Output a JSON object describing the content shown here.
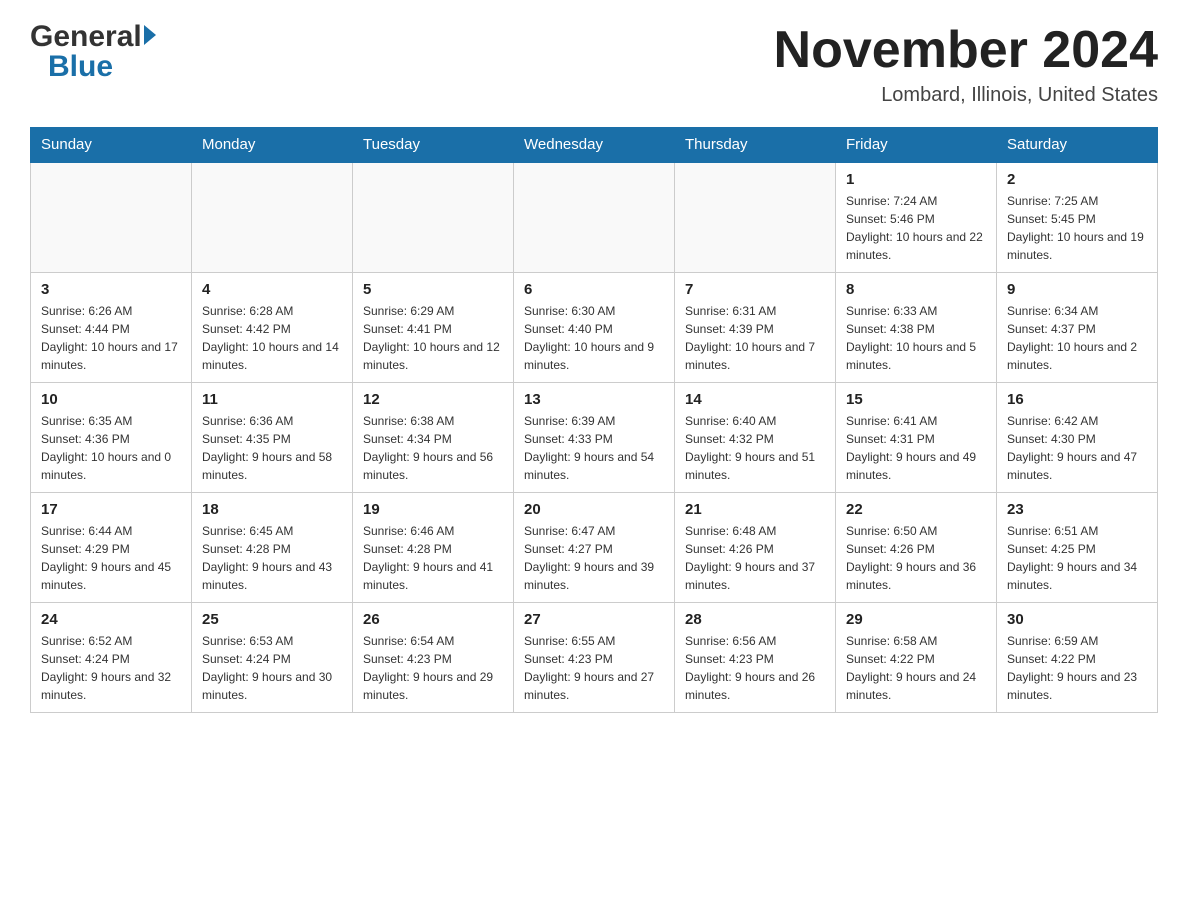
{
  "header": {
    "title": "November 2024",
    "subtitle": "Lombard, Illinois, United States",
    "logo_general": "General",
    "logo_blue": "Blue"
  },
  "days_of_week": [
    "Sunday",
    "Monday",
    "Tuesday",
    "Wednesday",
    "Thursday",
    "Friday",
    "Saturday"
  ],
  "weeks": [
    [
      {
        "day": "",
        "sunrise": "",
        "sunset": "",
        "daylight": ""
      },
      {
        "day": "",
        "sunrise": "",
        "sunset": "",
        "daylight": ""
      },
      {
        "day": "",
        "sunrise": "",
        "sunset": "",
        "daylight": ""
      },
      {
        "day": "",
        "sunrise": "",
        "sunset": "",
        "daylight": ""
      },
      {
        "day": "",
        "sunrise": "",
        "sunset": "",
        "daylight": ""
      },
      {
        "day": "1",
        "sunrise": "Sunrise: 7:24 AM",
        "sunset": "Sunset: 5:46 PM",
        "daylight": "Daylight: 10 hours and 22 minutes."
      },
      {
        "day": "2",
        "sunrise": "Sunrise: 7:25 AM",
        "sunset": "Sunset: 5:45 PM",
        "daylight": "Daylight: 10 hours and 19 minutes."
      }
    ],
    [
      {
        "day": "3",
        "sunrise": "Sunrise: 6:26 AM",
        "sunset": "Sunset: 4:44 PM",
        "daylight": "Daylight: 10 hours and 17 minutes."
      },
      {
        "day": "4",
        "sunrise": "Sunrise: 6:28 AM",
        "sunset": "Sunset: 4:42 PM",
        "daylight": "Daylight: 10 hours and 14 minutes."
      },
      {
        "day": "5",
        "sunrise": "Sunrise: 6:29 AM",
        "sunset": "Sunset: 4:41 PM",
        "daylight": "Daylight: 10 hours and 12 minutes."
      },
      {
        "day": "6",
        "sunrise": "Sunrise: 6:30 AM",
        "sunset": "Sunset: 4:40 PM",
        "daylight": "Daylight: 10 hours and 9 minutes."
      },
      {
        "day": "7",
        "sunrise": "Sunrise: 6:31 AM",
        "sunset": "Sunset: 4:39 PM",
        "daylight": "Daylight: 10 hours and 7 minutes."
      },
      {
        "day": "8",
        "sunrise": "Sunrise: 6:33 AM",
        "sunset": "Sunset: 4:38 PM",
        "daylight": "Daylight: 10 hours and 5 minutes."
      },
      {
        "day": "9",
        "sunrise": "Sunrise: 6:34 AM",
        "sunset": "Sunset: 4:37 PM",
        "daylight": "Daylight: 10 hours and 2 minutes."
      }
    ],
    [
      {
        "day": "10",
        "sunrise": "Sunrise: 6:35 AM",
        "sunset": "Sunset: 4:36 PM",
        "daylight": "Daylight: 10 hours and 0 minutes."
      },
      {
        "day": "11",
        "sunrise": "Sunrise: 6:36 AM",
        "sunset": "Sunset: 4:35 PM",
        "daylight": "Daylight: 9 hours and 58 minutes."
      },
      {
        "day": "12",
        "sunrise": "Sunrise: 6:38 AM",
        "sunset": "Sunset: 4:34 PM",
        "daylight": "Daylight: 9 hours and 56 minutes."
      },
      {
        "day": "13",
        "sunrise": "Sunrise: 6:39 AM",
        "sunset": "Sunset: 4:33 PM",
        "daylight": "Daylight: 9 hours and 54 minutes."
      },
      {
        "day": "14",
        "sunrise": "Sunrise: 6:40 AM",
        "sunset": "Sunset: 4:32 PM",
        "daylight": "Daylight: 9 hours and 51 minutes."
      },
      {
        "day": "15",
        "sunrise": "Sunrise: 6:41 AM",
        "sunset": "Sunset: 4:31 PM",
        "daylight": "Daylight: 9 hours and 49 minutes."
      },
      {
        "day": "16",
        "sunrise": "Sunrise: 6:42 AM",
        "sunset": "Sunset: 4:30 PM",
        "daylight": "Daylight: 9 hours and 47 minutes."
      }
    ],
    [
      {
        "day": "17",
        "sunrise": "Sunrise: 6:44 AM",
        "sunset": "Sunset: 4:29 PM",
        "daylight": "Daylight: 9 hours and 45 minutes."
      },
      {
        "day": "18",
        "sunrise": "Sunrise: 6:45 AM",
        "sunset": "Sunset: 4:28 PM",
        "daylight": "Daylight: 9 hours and 43 minutes."
      },
      {
        "day": "19",
        "sunrise": "Sunrise: 6:46 AM",
        "sunset": "Sunset: 4:28 PM",
        "daylight": "Daylight: 9 hours and 41 minutes."
      },
      {
        "day": "20",
        "sunrise": "Sunrise: 6:47 AM",
        "sunset": "Sunset: 4:27 PM",
        "daylight": "Daylight: 9 hours and 39 minutes."
      },
      {
        "day": "21",
        "sunrise": "Sunrise: 6:48 AM",
        "sunset": "Sunset: 4:26 PM",
        "daylight": "Daylight: 9 hours and 37 minutes."
      },
      {
        "day": "22",
        "sunrise": "Sunrise: 6:50 AM",
        "sunset": "Sunset: 4:26 PM",
        "daylight": "Daylight: 9 hours and 36 minutes."
      },
      {
        "day": "23",
        "sunrise": "Sunrise: 6:51 AM",
        "sunset": "Sunset: 4:25 PM",
        "daylight": "Daylight: 9 hours and 34 minutes."
      }
    ],
    [
      {
        "day": "24",
        "sunrise": "Sunrise: 6:52 AM",
        "sunset": "Sunset: 4:24 PM",
        "daylight": "Daylight: 9 hours and 32 minutes."
      },
      {
        "day": "25",
        "sunrise": "Sunrise: 6:53 AM",
        "sunset": "Sunset: 4:24 PM",
        "daylight": "Daylight: 9 hours and 30 minutes."
      },
      {
        "day": "26",
        "sunrise": "Sunrise: 6:54 AM",
        "sunset": "Sunset: 4:23 PM",
        "daylight": "Daylight: 9 hours and 29 minutes."
      },
      {
        "day": "27",
        "sunrise": "Sunrise: 6:55 AM",
        "sunset": "Sunset: 4:23 PM",
        "daylight": "Daylight: 9 hours and 27 minutes."
      },
      {
        "day": "28",
        "sunrise": "Sunrise: 6:56 AM",
        "sunset": "Sunset: 4:23 PM",
        "daylight": "Daylight: 9 hours and 26 minutes."
      },
      {
        "day": "29",
        "sunrise": "Sunrise: 6:58 AM",
        "sunset": "Sunset: 4:22 PM",
        "daylight": "Daylight: 9 hours and 24 minutes."
      },
      {
        "day": "30",
        "sunrise": "Sunrise: 6:59 AM",
        "sunset": "Sunset: 4:22 PM",
        "daylight": "Daylight: 9 hours and 23 minutes."
      }
    ]
  ]
}
